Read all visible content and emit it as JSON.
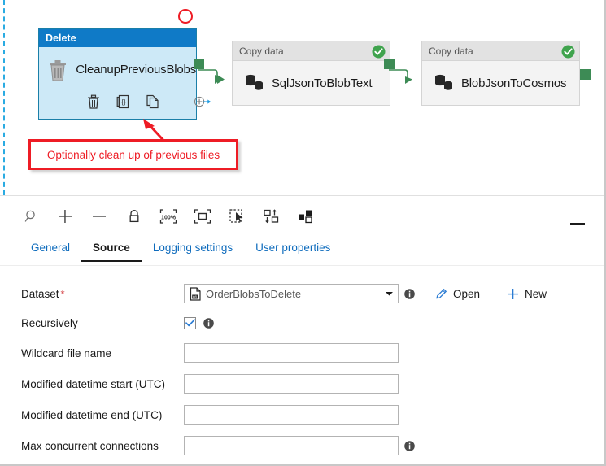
{
  "canvas": {
    "activities": [
      {
        "type_label": "Delete",
        "name": "CleanupPreviousBlobs",
        "selected": true,
        "icon": "trash-icon",
        "toolbar_icons": [
          "delete-icon",
          "code-icon",
          "clone-icon",
          "add-output-icon"
        ]
      },
      {
        "type_label": "Copy data",
        "name": "SqlJsonToBlobText",
        "selected": false,
        "icon": "copy-data-icon",
        "status": "success"
      },
      {
        "type_label": "Copy data",
        "name": "BlobJsonToCosmos",
        "selected": false,
        "icon": "copy-data-icon",
        "status": "success"
      }
    ],
    "annotation": {
      "callout_text": "Optionally clean up of previous files",
      "highlight_color": "#ee1c25"
    }
  },
  "panel": {
    "toolbar_icons": [
      "search-icon",
      "zoom-in-icon",
      "zoom-out-icon",
      "lock-icon",
      "zoom-100-icon",
      "fit-to-screen-icon",
      "select-tool-icon",
      "auto-align-icon",
      "grouping-icon"
    ],
    "minimize_label": "",
    "tabs": [
      {
        "label": "General",
        "active": false
      },
      {
        "label": "Source",
        "active": true
      },
      {
        "label": "Logging settings",
        "active": false
      },
      {
        "label": "User properties",
        "active": false
      }
    ],
    "fields": [
      {
        "label": "Dataset",
        "required": true,
        "control": "combo",
        "value": "OrderBlobsToDelete",
        "icon": "dataset-file-icon",
        "info": true,
        "actions": [
          {
            "label": "Open",
            "icon": "pencil-icon"
          },
          {
            "label": "New",
            "icon": "plus-icon"
          }
        ]
      },
      {
        "label": "Recursively",
        "required": false,
        "control": "checkbox",
        "checked": true,
        "info": true
      },
      {
        "label": "Wildcard file name",
        "required": false,
        "control": "text",
        "value": "",
        "info": false
      },
      {
        "label": "Modified datetime start (UTC)",
        "required": false,
        "control": "text",
        "value": "",
        "info": false
      },
      {
        "label": "Modified datetime end (UTC)",
        "required": false,
        "control": "text",
        "value": "",
        "info": false
      },
      {
        "label": "Max concurrent connections",
        "required": false,
        "control": "text",
        "value": "",
        "info": true
      }
    ]
  },
  "colors": {
    "selected_header": "#0f7ac7",
    "selected_body": "#cde9f7",
    "success_green": "#3d8b55",
    "accent_link": "#0f6cbd",
    "annotation_red": "#ee1c25"
  }
}
